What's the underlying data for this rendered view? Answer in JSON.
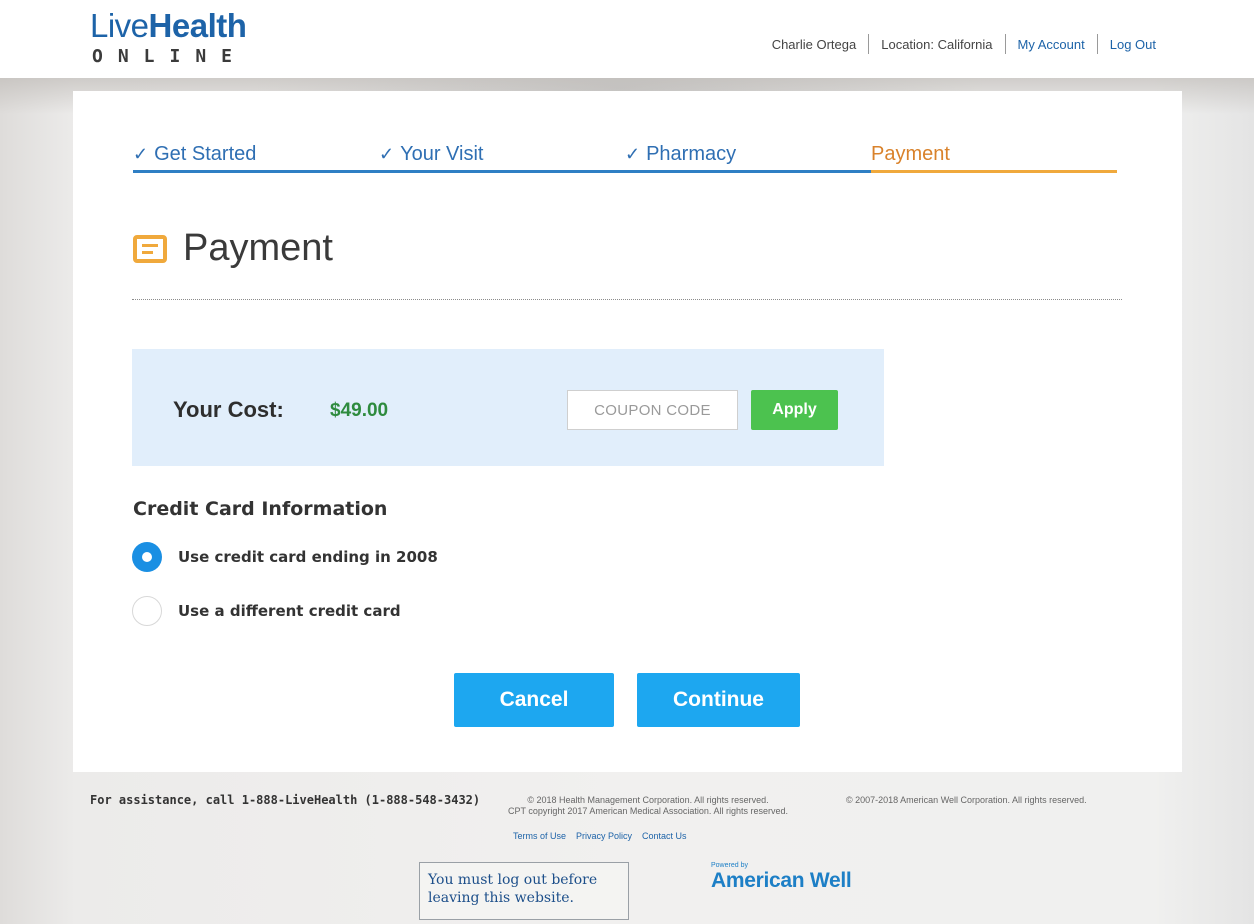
{
  "header": {
    "logo_live": "Live",
    "logo_health": "Health",
    "logo_online": "ONLINE",
    "user_name": "Charlie Ortega",
    "location": "Location: California",
    "my_account": "My Account",
    "log_out": "Log Out"
  },
  "steps": [
    {
      "label": "Get Started",
      "check": "✓"
    },
    {
      "label": "Your Visit",
      "check": "✓"
    },
    {
      "label": "Pharmacy",
      "check": "✓"
    },
    {
      "label": "Payment"
    }
  ],
  "page": {
    "title": "Payment",
    "title_icon": "payment-card-icon"
  },
  "cost": {
    "label": "Your Cost:",
    "value": "$49.00",
    "coupon_placeholder": "COUPON CODE",
    "apply_label": "Apply"
  },
  "credit_card": {
    "title": "Credit Card Information",
    "options": [
      {
        "label": "Use credit card ending in 2008",
        "selected": true
      },
      {
        "label": "Use a different credit card",
        "selected": false
      }
    ]
  },
  "actions": {
    "cancel_label": "Cancel",
    "continue_label": "Continue"
  },
  "footer": {
    "assistance": "For assistance, call 1-888-LiveHealth (1-888-548-3432)",
    "copyright_health": "© 2018 Health Management Corporation. All rights reserved.",
    "copyright_cpt": "CPT copyright 2017 American Medical Association. All rights reserved.",
    "copyright_amwell": "© 2007-2018 American Well Corporation. All rights reserved.",
    "links": [
      "Terms of Use",
      "Privacy Policy",
      "Contact Us"
    ],
    "logout_note": "You must log out before leaving this website.",
    "powered_by": "Powered by",
    "powered_name": "American Well"
  },
  "colors": {
    "brand_blue": "#1d63a8",
    "step_blue": "#2f7fc4",
    "step_active": "#f0a93c",
    "apply_green": "#4cc24f",
    "button_blue": "#1da7f0",
    "cost_green": "#2e8b3e"
  }
}
